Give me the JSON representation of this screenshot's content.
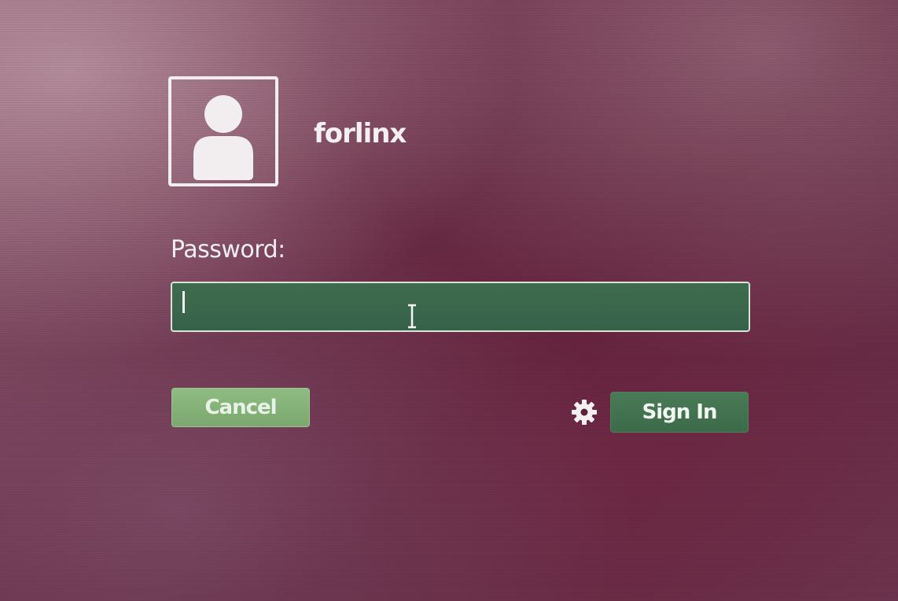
{
  "user": {
    "name": "forlinx",
    "avatar_icon": "user-silhouette-icon"
  },
  "password": {
    "label": "Password:",
    "value": ""
  },
  "buttons": {
    "cancel_label": "Cancel",
    "signin_label": "Sign In"
  },
  "settings": {
    "icon": "gear-icon"
  },
  "colors": {
    "background": "#5a2138",
    "input_bg": "#3f6b4e",
    "cancel_bg": "#8fbc82",
    "signin_bg": "#4a7b57",
    "text": "#f2eef0"
  }
}
